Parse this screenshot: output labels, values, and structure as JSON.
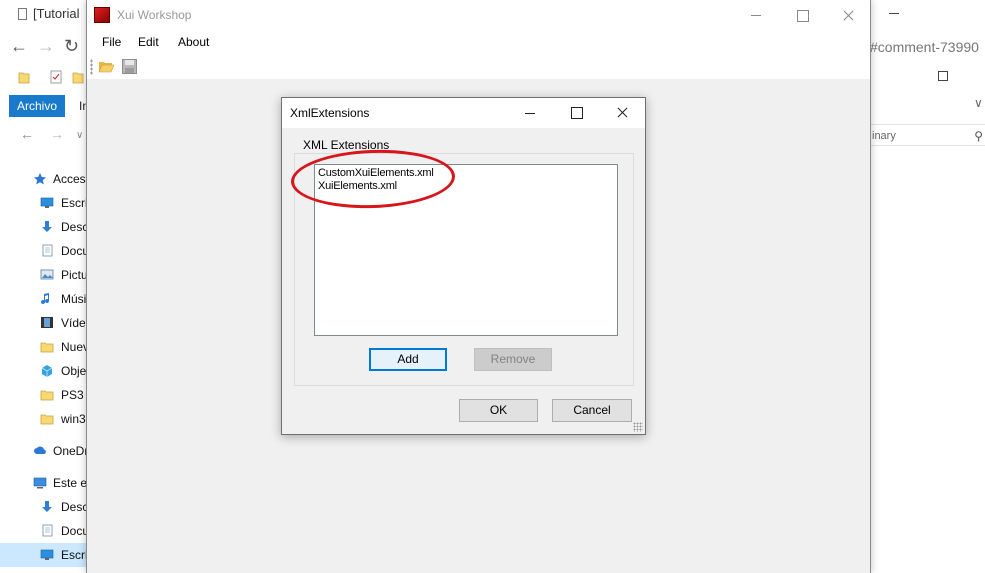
{
  "browser": {
    "tab_title": "[Tutorial",
    "url_tail": "#comment-73990"
  },
  "explorer": {
    "ribbon": {
      "archivo": "Archivo",
      "inicio": "In"
    },
    "search_tail": "inary",
    "nav_tree": [
      {
        "label": "Acceso",
        "icon": "star-icon",
        "level": "top"
      },
      {
        "label": "Escrit",
        "icon": "desktop-icon",
        "level": "child"
      },
      {
        "label": "Desc",
        "icon": "download-arrow-icon",
        "level": "child"
      },
      {
        "label": "Docu",
        "icon": "document-icon",
        "level": "child"
      },
      {
        "label": "Pictu",
        "icon": "pictures-icon",
        "level": "child"
      },
      {
        "label": "Músi",
        "icon": "music-note-icon",
        "level": "child"
      },
      {
        "label": "Vídeo",
        "icon": "film-icon",
        "level": "child"
      },
      {
        "label": "Nuev",
        "icon": "folder-icon",
        "level": "child"
      },
      {
        "label": "Obje",
        "icon": "cube-icon",
        "level": "child"
      },
      {
        "label": "PS3",
        "icon": "folder-icon",
        "level": "child"
      },
      {
        "label": "win3",
        "icon": "folder-icon",
        "level": "child"
      },
      {
        "label": "OneDr",
        "icon": "cloud-icon",
        "level": "top"
      },
      {
        "label": "Este e",
        "icon": "computer-icon",
        "level": "top"
      },
      {
        "label": "Desc",
        "icon": "download-arrow-icon",
        "level": "child"
      },
      {
        "label": "Docu",
        "icon": "document-icon",
        "level": "child"
      },
      {
        "label": "Escri",
        "icon": "desktop-icon",
        "level": "child"
      }
    ]
  },
  "app": {
    "title": "Xui Workshop",
    "menu": {
      "file": "File",
      "edit": "Edit",
      "about": "About"
    }
  },
  "dialog": {
    "title": "XmlExtensions",
    "group_label": "XML Extensions",
    "list_items": [
      "CustomXuiElements.xml",
      "XuiElements.xml"
    ],
    "buttons": {
      "add": "Add",
      "remove": "Remove",
      "ok": "OK",
      "cancel": "Cancel"
    }
  },
  "colors": {
    "annotation": "#d7151b",
    "ribbon_accent": "#1979ca",
    "default_button_border": "#0078d7"
  }
}
